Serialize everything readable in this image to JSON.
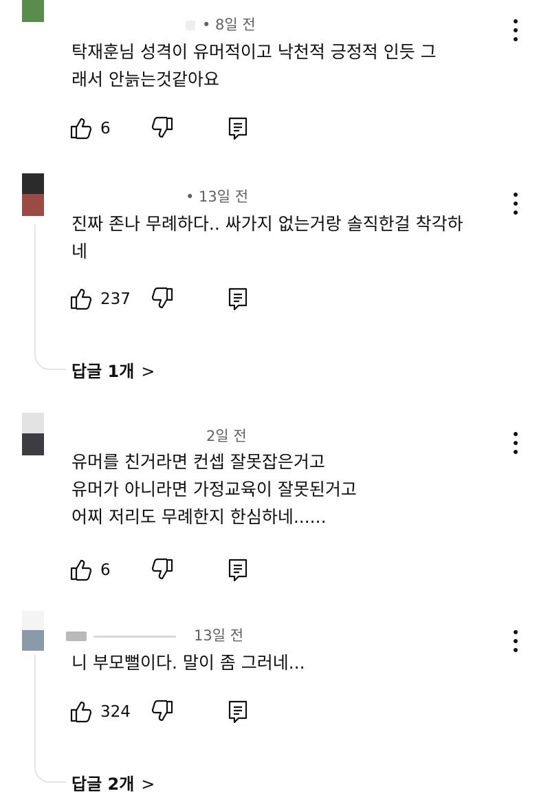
{
  "icons": {
    "like": "thumb-up-icon",
    "dislike": "thumb-down-icon",
    "reply": "reply-icon",
    "more": "more-vert-icon",
    "chevron": "chevron-right-icon"
  },
  "comments": [
    {
      "time": "• 8일 전",
      "lines": [
        "탁재훈님 성격이  유머적이고  낙천적  긍정적 인듯  그",
        "래서  안늙는것같아요"
      ],
      "likes": "6",
      "avatar_colors": [
        "#5a8c4e",
        "#ffffff"
      ]
    },
    {
      "time": "• 13일 전",
      "lines": [
        "진짜 존나 무례하다.. 싸가지 없는거랑 솔직한걸 착각하",
        "네"
      ],
      "likes": "237",
      "avatar_colors": [
        "#2b2b2b",
        "#9c4a44"
      ],
      "replies_label": "답글 1개",
      "replies_chevron": ">"
    },
    {
      "time": "2일 전",
      "lines": [
        "유머를 친거라면 컨셉 잘못잡은거고",
        "유머가 아니라면  가정교육이 잘못된거고",
        "어찌 저리도 무례한지 한심하네......"
      ],
      "likes": "6",
      "avatar_colors": [
        "#e3e3e3",
        "#3c3c42"
      ]
    },
    {
      "time": "13일 전",
      "lines": [
        "니 부모뻘이다. 말이 좀 그러네..."
      ],
      "likes": "324",
      "avatar_colors": [
        "#ffffff",
        "#8a9aa8"
      ],
      "replies_label": "답글 2개",
      "replies_chevron": ">"
    }
  ]
}
